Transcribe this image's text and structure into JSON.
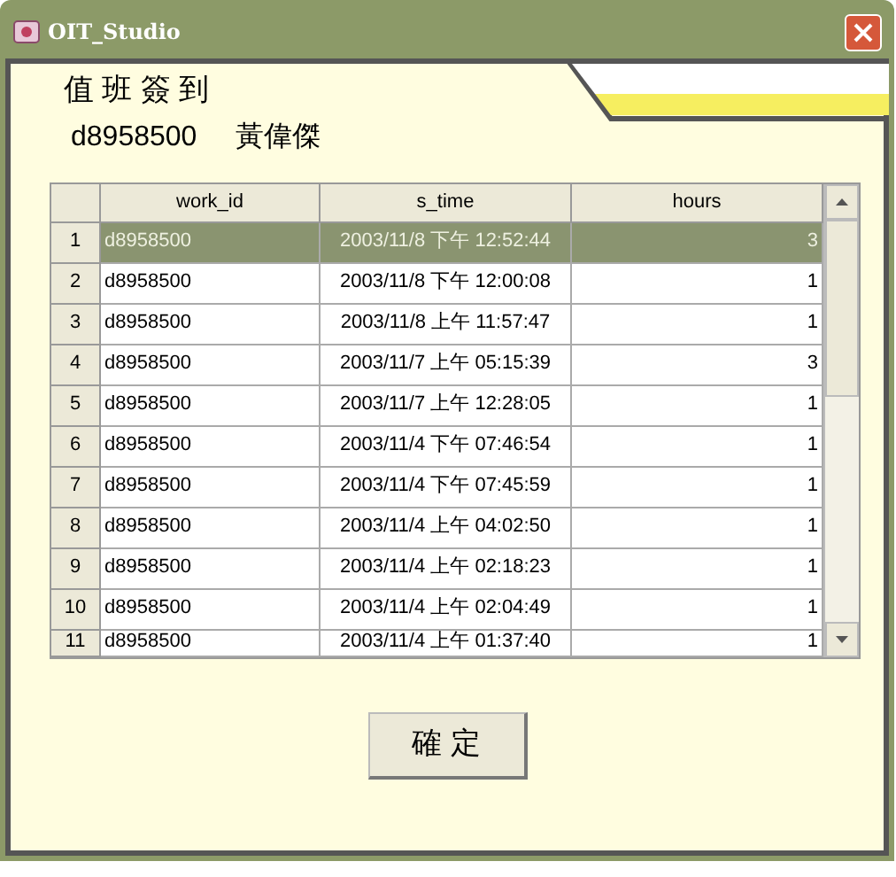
{
  "window": {
    "title": "OIT_Studio"
  },
  "heading": "值 班 簽 到",
  "user": {
    "id": "d8958500",
    "name": "黃偉傑"
  },
  "table": {
    "columns": [
      "work_id",
      "s_time",
      "hours"
    ],
    "rows": [
      {
        "number": "1",
        "work_id": "d8958500",
        "s_time": "2003/11/8 下午 12:52:44",
        "hours": "3",
        "selected": true
      },
      {
        "number": "2",
        "work_id": "d8958500",
        "s_time": "2003/11/8 下午 12:00:08",
        "hours": "1",
        "selected": false
      },
      {
        "number": "3",
        "work_id": "d8958500",
        "s_time": "2003/11/8 上午 11:57:47",
        "hours": "1",
        "selected": false
      },
      {
        "number": "4",
        "work_id": "d8958500",
        "s_time": "2003/11/7 上午 05:15:39",
        "hours": "3",
        "selected": false
      },
      {
        "number": "5",
        "work_id": "d8958500",
        "s_time": "2003/11/7 上午 12:28:05",
        "hours": "1",
        "selected": false
      },
      {
        "number": "6",
        "work_id": "d8958500",
        "s_time": "2003/11/4 下午 07:46:54",
        "hours": "1",
        "selected": false
      },
      {
        "number": "7",
        "work_id": "d8958500",
        "s_time": "2003/11/4 下午 07:45:59",
        "hours": "1",
        "selected": false
      },
      {
        "number": "8",
        "work_id": "d8958500",
        "s_time": "2003/11/4 上午 04:02:50",
        "hours": "1",
        "selected": false
      },
      {
        "number": "9",
        "work_id": "d8958500",
        "s_time": "2003/11/4 上午 02:18:23",
        "hours": "1",
        "selected": false
      },
      {
        "number": "10",
        "work_id": "d8958500",
        "s_time": "2003/11/4 上午 02:04:49",
        "hours": "1",
        "selected": false
      },
      {
        "number": "11",
        "work_id": "d8958500",
        "s_time": "2003/11/4 上午 01:37:40",
        "hours": "1",
        "selected": false
      }
    ]
  },
  "buttons": [
    "確 定"
  ]
}
